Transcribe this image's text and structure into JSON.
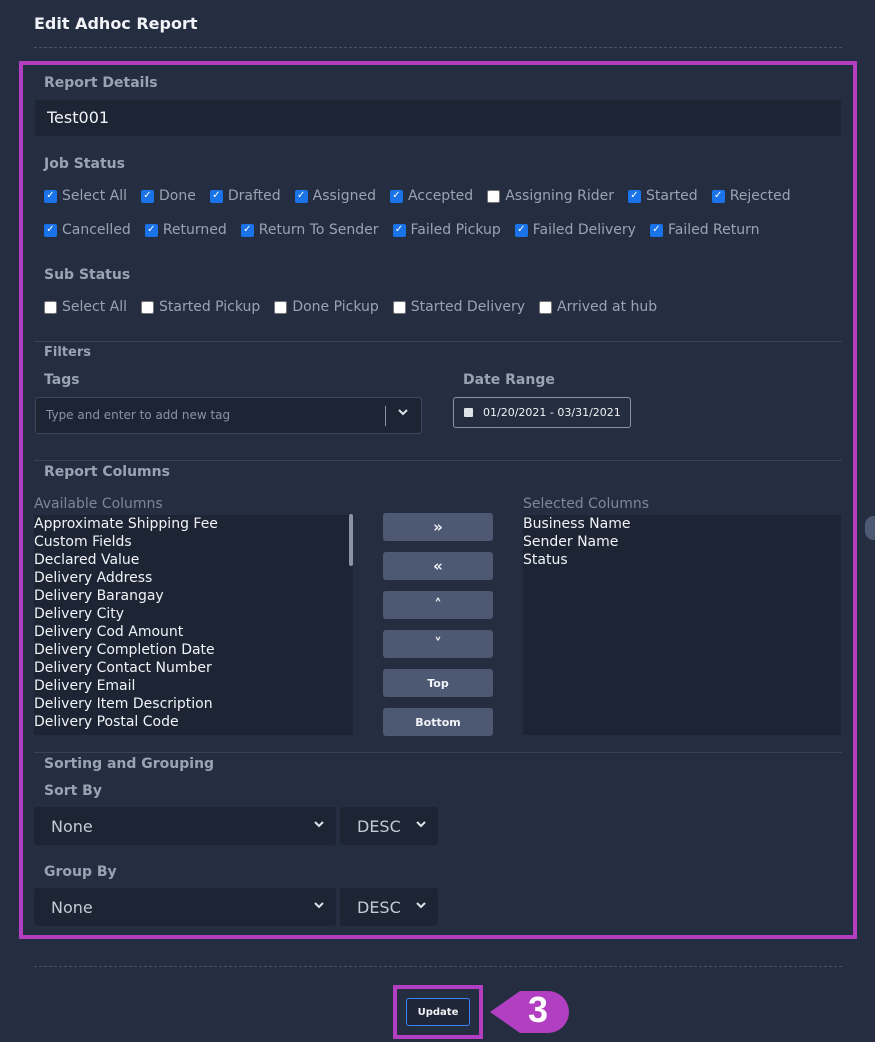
{
  "page": {
    "title": "Edit Adhoc Report"
  },
  "report_details": {
    "label": "Report Details",
    "name_value": "Test001"
  },
  "job_status": {
    "label": "Job Status",
    "row1": [
      {
        "label": "Select All",
        "checked": true
      },
      {
        "label": "Done",
        "checked": true
      },
      {
        "label": "Drafted",
        "checked": true
      },
      {
        "label": "Assigned",
        "checked": true
      },
      {
        "label": "Accepted",
        "checked": true
      },
      {
        "label": "Assigning Rider",
        "checked": false
      },
      {
        "label": "Started",
        "checked": true
      },
      {
        "label": "Rejected",
        "checked": true
      }
    ],
    "row2": [
      {
        "label": "Cancelled",
        "checked": true
      },
      {
        "label": "Returned",
        "checked": true
      },
      {
        "label": "Return To Sender",
        "checked": true
      },
      {
        "label": "Failed Pickup",
        "checked": true
      },
      {
        "label": "Failed Delivery",
        "checked": true
      },
      {
        "label": "Failed Return",
        "checked": true
      }
    ]
  },
  "sub_status": {
    "label": "Sub Status",
    "items": [
      {
        "label": "Select All",
        "checked": false
      },
      {
        "label": "Started Pickup",
        "checked": false
      },
      {
        "label": "Done Pickup",
        "checked": false
      },
      {
        "label": "Started Delivery",
        "checked": false
      },
      {
        "label": "Arrived at hub",
        "checked": false
      }
    ]
  },
  "filters": {
    "label": "Filters",
    "tags_label": "Tags",
    "tags_placeholder": "Type and enter to add new tag",
    "date_range_label": "Date Range",
    "date_range_value": "01/20/2021 - 03/31/2021"
  },
  "report_columns": {
    "label": "Report Columns",
    "available_label": "Available Columns",
    "selected_label": "Selected Columns",
    "available": [
      "Approximate Shipping Fee",
      "Custom Fields",
      "Declared Value",
      "Delivery Address",
      "Delivery Barangay",
      "Delivery City",
      "Delivery Cod Amount",
      "Delivery Completion Date",
      "Delivery Contact Number",
      "Delivery Email",
      "Delivery Item Description",
      "Delivery Postal Code"
    ],
    "selected": [
      "Business Name",
      "Sender Name",
      "Status"
    ],
    "buttons": {
      "add_all": "»",
      "remove_all": "«",
      "move_up": "˄",
      "move_down": "˅",
      "top": "Top",
      "bottom": "Bottom"
    }
  },
  "sorting": {
    "label": "Sorting and Grouping",
    "sort_by_label": "Sort By",
    "sort_by_value": "None",
    "sort_order_value": "DESC",
    "group_by_label": "Group By",
    "group_by_value": "None",
    "group_order_value": "DESC"
  },
  "footer": {
    "update_label": "Update",
    "callout_number": "3"
  },
  "colors": {
    "highlight": "#b23fc1",
    "background": "#252e41",
    "checkbox": "#1a73e8"
  }
}
